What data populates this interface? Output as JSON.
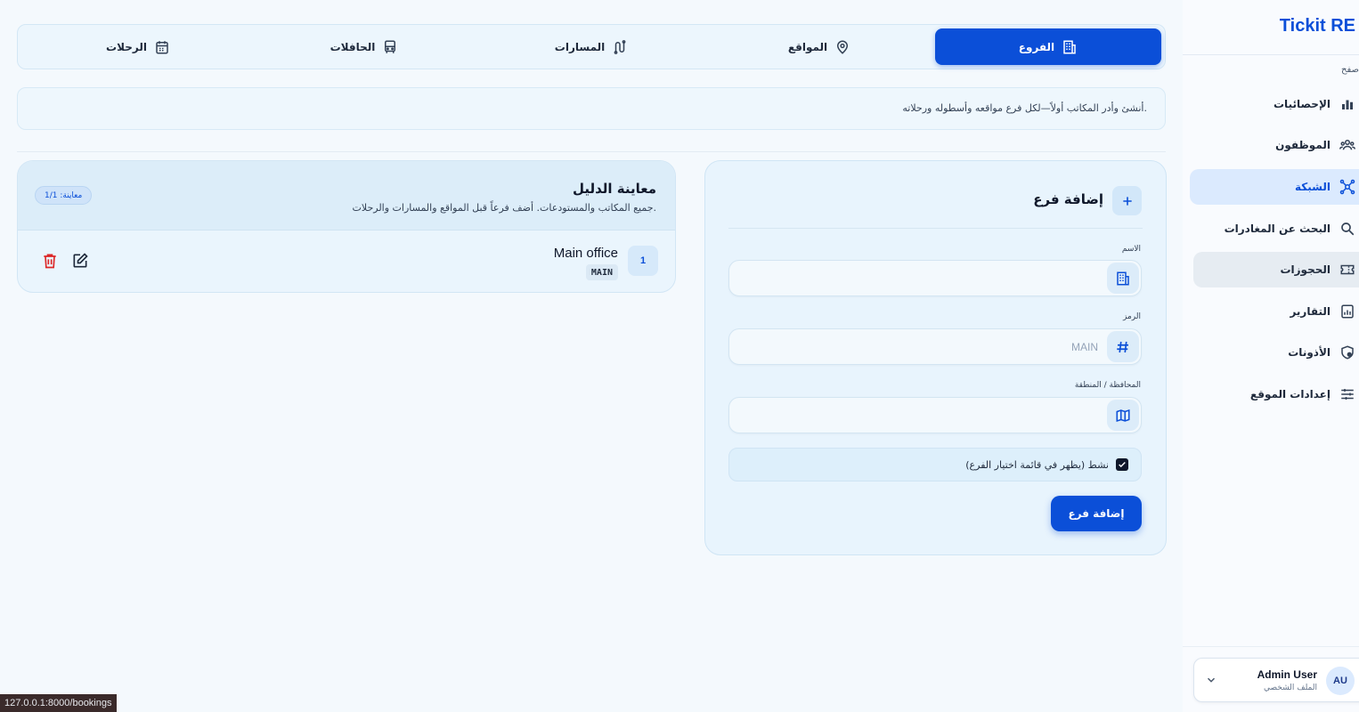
{
  "sidebar": {
    "brand": "Tickit RE",
    "section_label": "صفح",
    "items": [
      {
        "label": "الإحصائيات",
        "icon": "bar-chart-icon"
      },
      {
        "label": "الموظفون",
        "icon": "users-icon"
      },
      {
        "label": "الشبكة",
        "icon": "network-icon",
        "active": true
      },
      {
        "label": "البحث عن المغادرات",
        "icon": "search-icon"
      },
      {
        "label": "الحجوزات",
        "icon": "ticket-icon",
        "hovered": true
      },
      {
        "label": "التقارير",
        "icon": "report-icon"
      },
      {
        "label": "الأذونات",
        "icon": "shield-icon"
      },
      {
        "label": "إعدادات الموقع",
        "icon": "sliders-icon"
      }
    ],
    "user": {
      "initials": "AU",
      "name": "Admin User",
      "subtitle": "الملف الشخصي"
    }
  },
  "tabs": [
    {
      "label": "الفروع",
      "icon": "building-icon",
      "active": true
    },
    {
      "label": "المواقع",
      "icon": "map-pin-icon"
    },
    {
      "label": "المسارات",
      "icon": "route-icon"
    },
    {
      "label": "الحافلات",
      "icon": "bus-icon"
    },
    {
      "label": "الرحلات",
      "icon": "calendar-icon"
    }
  ],
  "banner": {
    "text": "أنشئ وأدر المكاتب أولاً—لكل فرع مواقعه وأسطوله ورحلاته."
  },
  "form": {
    "title": "إضافة فرع",
    "fields": {
      "name": {
        "label": "الاسم",
        "value": "",
        "placeholder": ""
      },
      "code": {
        "label": "الرمز",
        "value": "",
        "placeholder": "MAIN"
      },
      "region": {
        "label": "المحافظة / المنطقة",
        "value": "",
        "placeholder": ""
      }
    },
    "active_label": "نشط (يظهر في قائمة اختيار الفرع)",
    "active_checked": true,
    "submit_label": "إضافة فرع"
  },
  "directory": {
    "title": "معاينة الدليل",
    "subtitle": "جميع المكاتب والمستودعات. أضف فرعاً قبل المواقع والمسارات والرحلات.",
    "badge": "معاينة: 1/1",
    "rows": [
      {
        "index": "1",
        "name": "Main office",
        "code": "MAIN"
      }
    ]
  },
  "statusbar": {
    "url": "127.0.0.1:8000/bookings"
  },
  "colors": {
    "accent": "#0b4fd8",
    "danger": "#dc2626",
    "background": "#f4f9fd"
  }
}
